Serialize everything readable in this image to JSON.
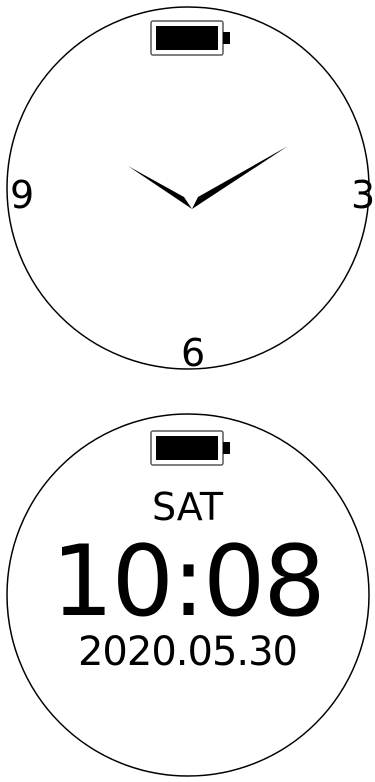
{
  "analog_face": {
    "numerals": {
      "nine": "9",
      "three": "3",
      "six": "6"
    },
    "battery_icon": "battery-full-icon"
  },
  "digital_face": {
    "day": "SAT",
    "time": "10:08",
    "date": "2020.05.30",
    "battery_icon": "battery-full-icon"
  },
  "colors": {
    "background": "#ffffff",
    "ink": "#000000",
    "battery_outline": "#555555"
  }
}
